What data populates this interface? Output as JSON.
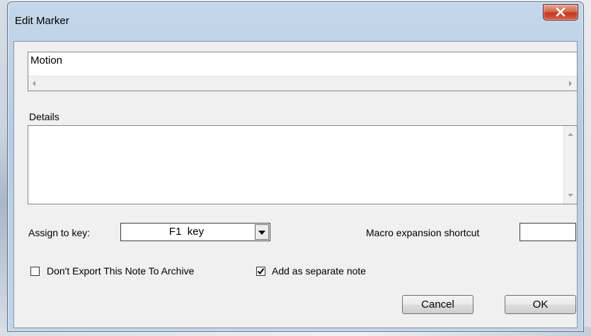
{
  "window": {
    "title": "Edit Marker"
  },
  "marker": {
    "value": "Motion"
  },
  "details": {
    "label": "Details",
    "value": ""
  },
  "assign_key": {
    "label": "Assign to key:",
    "selected": "F1  key"
  },
  "macro": {
    "label": "Macro expansion shortcut",
    "value": ""
  },
  "options": {
    "dont_export_label": "Don't Export This Note To Archive",
    "dont_export_checked": false,
    "separate_note_label": "Add as separate note",
    "separate_note_checked": true
  },
  "buttons": {
    "cancel": "Cancel",
    "ok": "OK"
  },
  "icons": {
    "close": "close-icon",
    "checkmark": "checkmark-icon"
  },
  "colors": {
    "titlebar": "#c2d4e8",
    "close_button": "#c2391c",
    "dialog_bg": "#f0f0f0"
  }
}
